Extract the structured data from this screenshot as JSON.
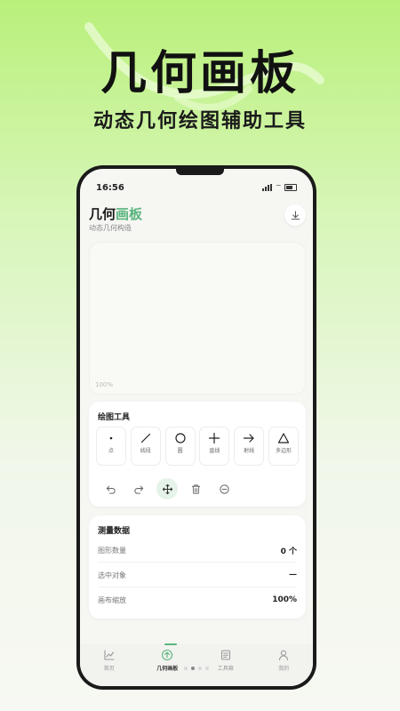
{
  "promo": {
    "title": "几何画板",
    "subtitle": "动态几何绘图辅助工具"
  },
  "status_bar": {
    "time": "16:56"
  },
  "header": {
    "title_part1": "几何",
    "title_part2": "画板",
    "subtitle": "动态几何构造",
    "download_icon": "download-icon"
  },
  "canvas": {
    "zoom_label": "100%"
  },
  "tools_card": {
    "title": "绘图工具",
    "tools": [
      {
        "label": "点",
        "icon": "point-icon"
      },
      {
        "label": "线段",
        "icon": "segment-icon"
      },
      {
        "label": "圆",
        "icon": "circle-icon"
      },
      {
        "label": "直线",
        "icon": "line-icon"
      },
      {
        "label": "射线",
        "icon": "ray-icon"
      },
      {
        "label": "多边形",
        "icon": "polygon-icon"
      }
    ],
    "actions": [
      "undo-icon",
      "redo-icon",
      "move-icon",
      "delete-icon",
      "zoom-out-icon"
    ]
  },
  "data_card": {
    "title": "测量数据",
    "rows": [
      {
        "label": "图形数量",
        "value": "0 个"
      },
      {
        "label": "选中对象",
        "value": "—"
      },
      {
        "label": "画布缩放",
        "value": "100%"
      }
    ]
  },
  "nav": {
    "items": [
      {
        "label": "首页",
        "icon": "chart-line-icon"
      },
      {
        "label": "几何画板",
        "icon": "add-circle-icon"
      },
      {
        "label": "工具箱",
        "icon": "list-icon"
      },
      {
        "label": "我的",
        "icon": "user-icon"
      }
    ],
    "active_index": 1
  },
  "colors": {
    "accent": "#5ab57e",
    "background_top": "#b9f07a"
  }
}
